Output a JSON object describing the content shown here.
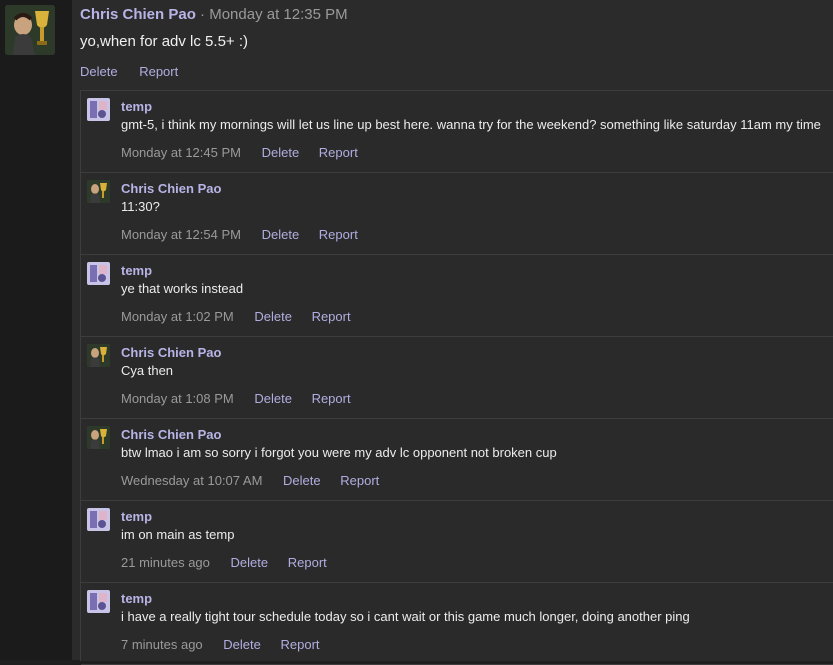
{
  "colors": {
    "author": "#b7b4e6",
    "action": "#b0aee0",
    "muted": "#9a9a9a",
    "background": "#2b2b2b"
  },
  "top_post": {
    "author": "Chris Chien Pao",
    "separator": "·",
    "time": "Monday at 12:35 PM",
    "body": "yo,when for adv lc 5.5+ :)",
    "delete_label": "Delete",
    "report_label": "Report"
  },
  "replies": [
    {
      "author": "temp",
      "body": "gmt-5, i think my mornings will let us line up best here. wanna try for the weekend? something like saturday 11am my time",
      "time": "Monday at 12:45 PM",
      "delete_label": "Delete",
      "report_label": "Report"
    },
    {
      "author": "Chris Chien Pao",
      "body": "11:30?",
      "time": "Monday at 12:54 PM",
      "delete_label": "Delete",
      "report_label": "Report"
    },
    {
      "author": "temp",
      "body": "ye that works instead",
      "time": "Monday at 1:02 PM",
      "delete_label": "Delete",
      "report_label": "Report"
    },
    {
      "author": "Chris Chien Pao",
      "body": "Cya then",
      "time": "Monday at 1:08 PM",
      "delete_label": "Delete",
      "report_label": "Report"
    },
    {
      "author": "Chris Chien Pao",
      "body": "btw lmao i am so sorry i forgot you were my adv lc opponent not broken cup",
      "time": "Wednesday at 10:07 AM",
      "delete_label": "Delete",
      "report_label": "Report"
    },
    {
      "author": "temp",
      "body": "im on main as temp",
      "time": "21 minutes ago",
      "delete_label": "Delete",
      "report_label": "Report"
    },
    {
      "author": "temp",
      "body": "i have a really tight tour schedule today so i cant wait or this game much longer, doing another ping",
      "time": "7 minutes ago",
      "delete_label": "Delete",
      "report_label": "Report"
    }
  ]
}
